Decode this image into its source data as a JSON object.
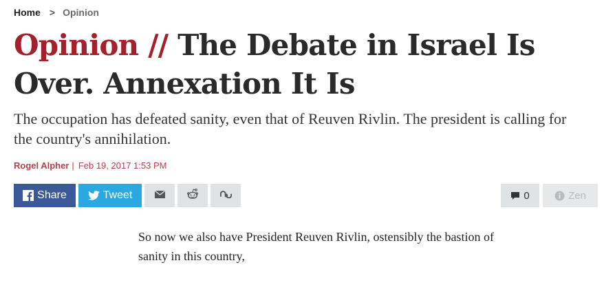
{
  "breadcrumb": {
    "home": "Home",
    "separator": ">",
    "current": "Opinion"
  },
  "headline": {
    "section": "Opinion",
    "slashes": "//",
    "title": "The Debate in Israel Is Over. Annexation It Is"
  },
  "subtitle": "The occupation has defeated sanity, even that of Reuven Rivlin. The president is calling for the country's annihilation.",
  "byline": {
    "author": "Rogel Alpher",
    "separator": "|",
    "date": "Feb 19, 2017 1:53 PM"
  },
  "share": {
    "facebook_label": "Share",
    "twitter_label": "Tweet",
    "email_icon": "envelope-icon",
    "reddit_icon": "reddit-icon",
    "stumble_icon": "stumbleupon-icon",
    "comments_count": "0",
    "zen_label": "Zen"
  },
  "colors": {
    "accent": "#a3202c",
    "facebook": "#3b5998",
    "twitter": "#2aa9e0",
    "button_gray": "#dfe3e6"
  },
  "article": {
    "first_paragraph": "So now we also have President Reuven Rivlin, ostensibly the bastion of sanity in this country,"
  }
}
